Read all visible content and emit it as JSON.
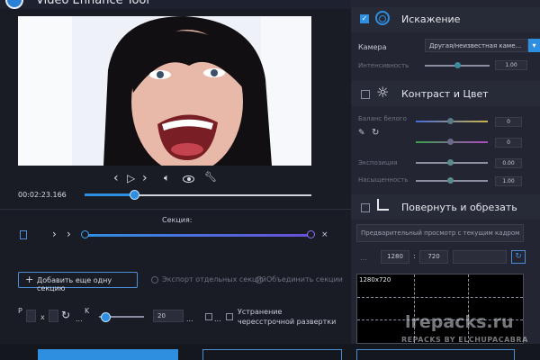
{
  "app": {
    "title": "Video Enhance Tool"
  },
  "player": {
    "time": "00:02:23.166",
    "progress": 0.23
  },
  "section": {
    "label": "Секция:",
    "add_button": "Добавить еще одну секцию",
    "export_separate": "Экспорт отдельных секций",
    "merge_all": "Объединить секции"
  },
  "resize": {
    "p_label": "P",
    "x_label": "x",
    "k_label": "K",
    "value": "20",
    "dots1": "...",
    "dots2": "...",
    "dots3": "...",
    "deinterlace": "Устранение чересстрочной развертки"
  },
  "panels": {
    "distortion": {
      "title": "Искажение",
      "camera_label": "Камера",
      "camera_value": "Другая/неизвестная каме...",
      "intensity_label": "Интенсивность",
      "intensity_value": "1.00"
    },
    "contrast": {
      "title": "Контраст и Цвет",
      "white_balance_label": "Баланс белого",
      "wb_value1": "0",
      "wb_value2": "0",
      "exposure_label": "Экспозиция",
      "exposure_value": "0.00",
      "saturation_label": "Насыщенность",
      "saturation_value": "1.00"
    },
    "rotate": {
      "title": "Повернуть и обрезать",
      "preview_placeholder": "Предварительный просмотр с текущим кадром",
      "width": "1280",
      "height": "720",
      "preview_size": "1280x720"
    }
  },
  "watermark": {
    "line1": "lrepacks.ru",
    "line2": "REPACKS BY ELCHUPACABRA"
  },
  "colors": {
    "accent": "#2e8fe0",
    "section_bar": "#6a4fd8"
  }
}
